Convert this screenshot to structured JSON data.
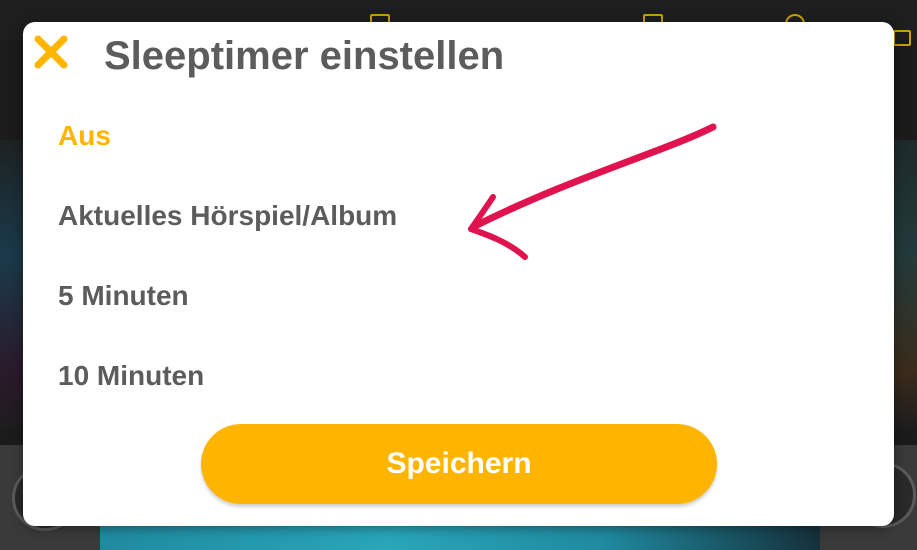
{
  "dialog": {
    "title": "Sleeptimer einstellen",
    "close_icon": "close-x-icon",
    "options": [
      {
        "label": "Aus",
        "selected": true
      },
      {
        "label": "Aktuelles Hörspiel/Album",
        "selected": false
      },
      {
        "label": "5 Minuten",
        "selected": false
      },
      {
        "label": "10 Minuten",
        "selected": false
      }
    ],
    "save_label": "Speichern"
  },
  "annotation": {
    "icon": "red-hand-drawn-arrow-icon",
    "color": "#e0134f"
  },
  "colors": {
    "accent": "#ffb400",
    "text": "#5c5c5c",
    "dialog_bg": "#ffffff"
  }
}
